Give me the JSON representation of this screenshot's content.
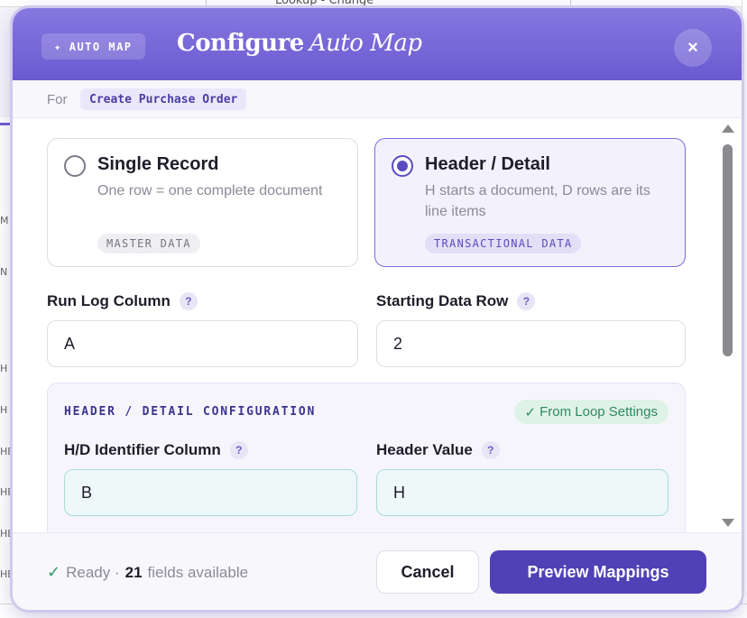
{
  "background": {
    "top_text": "Lookup - Change",
    "left_cells": [
      "M",
      "N",
      "H",
      "H",
      "HE",
      "HE",
      "HE",
      "HE"
    ]
  },
  "modal": {
    "tag": "AUTO MAP",
    "tag_icon": "sparkle-icon",
    "title_main": "Configure",
    "title_italic": "Auto Map",
    "close_label": "×",
    "for_label": "For",
    "for_value": "Create Purchase Order"
  },
  "modes": [
    {
      "title": "Single Record",
      "description": "One row = one complete document",
      "badge": "MASTER DATA",
      "selected": false
    },
    {
      "title": "Header / Detail",
      "description": "H starts a document, D rows are its line items",
      "badge": "TRANSACTIONAL DATA",
      "selected": true
    }
  ],
  "fields": {
    "run_log_label": "Run Log Column",
    "run_log_value": "A",
    "start_row_label": "Starting Data Row",
    "start_row_value": "2",
    "help_glyph": "?"
  },
  "hd_config": {
    "title": "HEADER / DETAIL CONFIGURATION",
    "badge": "From Loop Settings",
    "badge_check": "✓",
    "identifier_label": "H/D Identifier Column",
    "identifier_value": "B",
    "header_value_label": "Header Value",
    "header_value_value": "H"
  },
  "footer": {
    "status_check": "✓",
    "status_prefix": "Ready ·",
    "field_count": "21",
    "status_suffix": "fields available",
    "cancel_label": "Cancel",
    "preview_label": "Preview Mappings"
  },
  "colors": {
    "accent": "#5041b6",
    "header_gradient_top": "#8677e0",
    "success": "#2e9a6a"
  }
}
